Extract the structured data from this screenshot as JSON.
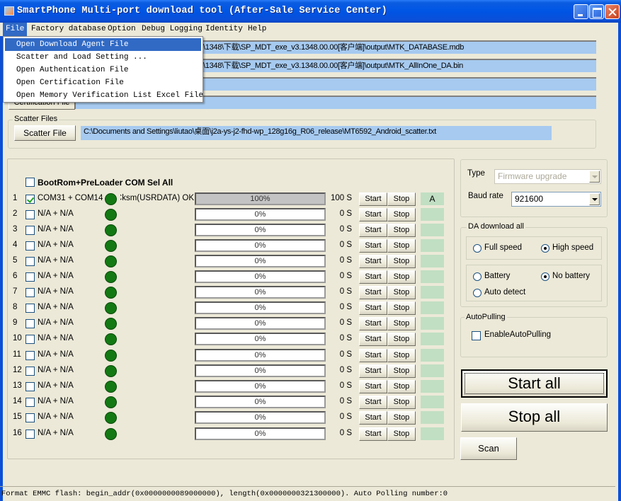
{
  "window": {
    "title": "SmartPhone Multi-port download tool (After-Sale Service Center)"
  },
  "menubar": {
    "items": [
      {
        "label": "File",
        "active": true
      },
      {
        "label": "Factory database"
      },
      {
        "label": "Option"
      },
      {
        "label": "Debug Logging"
      },
      {
        "label": "Identity"
      },
      {
        "label": "Help"
      }
    ]
  },
  "file_menu": {
    "items": [
      {
        "label": "Open Download Agent File",
        "highlighted": true
      },
      {
        "label": "Scatter and Load Setting ..."
      },
      {
        "label": "Open Authentication File"
      },
      {
        "label": "Open Certification File"
      },
      {
        "label": "Open Memory Verification List Excel File"
      }
    ]
  },
  "files": {
    "database_path": "\\1348\\下载\\SP_MDT_exe_v3.1348.00.00[客户端]\\output\\MTK_DATABASE.mdb",
    "da_path": "\\1348\\下载\\SP_MDT_exe_v3.1348.00.00[客户端]\\output\\MTK_AllInOne_DA.bin",
    "authentication_path": "",
    "certification_path": "",
    "certification_label": "Certification File"
  },
  "scatter": {
    "group_label": "Scatter Files",
    "button_label": "Scatter File",
    "path": "C:\\Documents and Settings\\liutao\\桌面\\j2a-ys-j2-fhd-wp_128g16g_R06_release\\MT6592_Android_scatter.txt"
  },
  "ports": {
    "select_all_label": "BootRom+PreLoader COM Sel All",
    "select_all_checked": false,
    "start_label": "Start",
    "stop_label": "Stop",
    "rows": [
      {
        "num": "1",
        "checked": true,
        "port": "COM31 + COM14",
        "status": "Cksm(USRDATA) OK",
        "progress": 100,
        "progress_text": "100%",
        "time": "100 S",
        "flag": "A"
      },
      {
        "num": "2",
        "checked": false,
        "port": "N/A + N/A",
        "status": "",
        "progress": 0,
        "progress_text": "0%",
        "time": "0 S",
        "flag": ""
      },
      {
        "num": "3",
        "checked": false,
        "port": "N/A + N/A",
        "status": "",
        "progress": 0,
        "progress_text": "0%",
        "time": "0 S",
        "flag": ""
      },
      {
        "num": "4",
        "checked": false,
        "port": "N/A + N/A",
        "status": "",
        "progress": 0,
        "progress_text": "0%",
        "time": "0 S",
        "flag": ""
      },
      {
        "num": "5",
        "checked": false,
        "port": "N/A + N/A",
        "status": "",
        "progress": 0,
        "progress_text": "0%",
        "time": "0 S",
        "flag": ""
      },
      {
        "num": "6",
        "checked": false,
        "port": "N/A + N/A",
        "status": "",
        "progress": 0,
        "progress_text": "0%",
        "time": "0 S",
        "flag": ""
      },
      {
        "num": "7",
        "checked": false,
        "port": "N/A + N/A",
        "status": "",
        "progress": 0,
        "progress_text": "0%",
        "time": "0 S",
        "flag": ""
      },
      {
        "num": "8",
        "checked": false,
        "port": "N/A + N/A",
        "status": "",
        "progress": 0,
        "progress_text": "0%",
        "time": "0 S",
        "flag": ""
      },
      {
        "num": "9",
        "checked": false,
        "port": "N/A + N/A",
        "status": "",
        "progress": 0,
        "progress_text": "0%",
        "time": "0 S",
        "flag": ""
      },
      {
        "num": "10",
        "checked": false,
        "port": "N/A + N/A",
        "status": "",
        "progress": 0,
        "progress_text": "0%",
        "time": "0 S",
        "flag": ""
      },
      {
        "num": "11",
        "checked": false,
        "port": "N/A + N/A",
        "status": "",
        "progress": 0,
        "progress_text": "0%",
        "time": "0 S",
        "flag": ""
      },
      {
        "num": "12",
        "checked": false,
        "port": "N/A + N/A",
        "status": "",
        "progress": 0,
        "progress_text": "0%",
        "time": "0 S",
        "flag": ""
      },
      {
        "num": "13",
        "checked": false,
        "port": "N/A + N/A",
        "status": "",
        "progress": 0,
        "progress_text": "0%",
        "time": "0 S",
        "flag": ""
      },
      {
        "num": "14",
        "checked": false,
        "port": "N/A + N/A",
        "status": "",
        "progress": 0,
        "progress_text": "0%",
        "time": "0 S",
        "flag": ""
      },
      {
        "num": "15",
        "checked": false,
        "port": "N/A + N/A",
        "status": "",
        "progress": 0,
        "progress_text": "0%",
        "time": "0 S",
        "flag": ""
      },
      {
        "num": "16",
        "checked": false,
        "port": "N/A + N/A",
        "status": "",
        "progress": 0,
        "progress_text": "0%",
        "time": "0 S",
        "flag": ""
      }
    ]
  },
  "settings": {
    "type_label": "Type",
    "type_value": "Firmware upgrade",
    "baud_label": "Baud rate",
    "baud_value": "921600",
    "da_group_label": "DA download all",
    "full_speed_label": "Full speed",
    "high_speed_label": "High speed",
    "speed_selected": "High speed",
    "battery_label": "Battery",
    "no_battery_label": "No battery",
    "auto_detect_label": "Auto detect",
    "battery_selected": "No battery",
    "autopulling_group_label": "AutoPulling",
    "enable_autopulling_label": "EnableAutoPulling",
    "enable_autopulling_checked": false
  },
  "actions": {
    "start_all": "Start all",
    "stop_all": "Stop all",
    "scan": "Scan"
  },
  "statusbar": {
    "text": "Format EMMC flash:  begin_addr(0x0000000089000000), length(0x0000000321300000). Auto Polling number:0"
  }
}
